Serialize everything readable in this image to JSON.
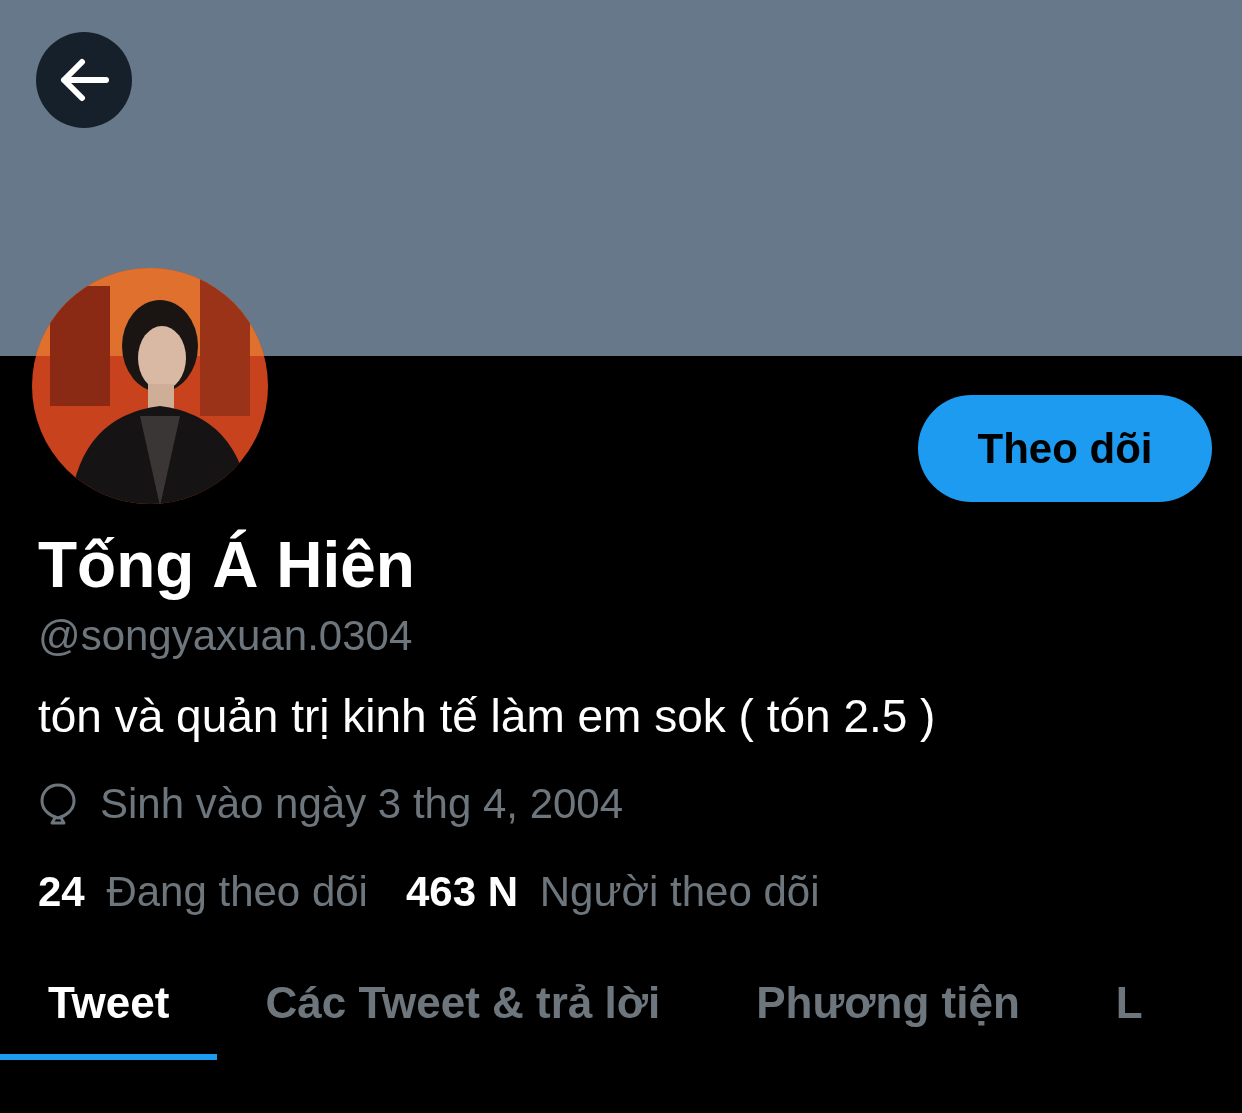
{
  "follow_button": {
    "label": "Theo dõi"
  },
  "profile": {
    "name": "Tống Á Hiên",
    "handle": "@songyaxuan.0304",
    "bio": "tón và quản trị kinh tế làm em sok ( tón 2.5 )",
    "birthday": "Sinh vào ngày 3 thg 4, 2004"
  },
  "stats": [
    {
      "count": "24",
      "label": "Đang theo dõi"
    },
    {
      "count": "463 N",
      "label": "Người theo dõi"
    }
  ],
  "tabs": [
    {
      "label": "Tweet",
      "selected": true
    },
    {
      "label": "Các Tweet & trả lời",
      "selected": false
    },
    {
      "label": "Phương tiện",
      "selected": false
    },
    {
      "label": "L",
      "selected": false
    }
  ]
}
